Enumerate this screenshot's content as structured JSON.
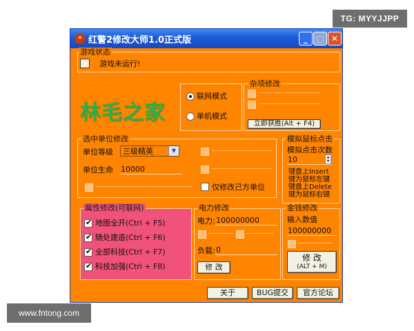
{
  "watermarks": {
    "top_right": "TG: MYYJJPP",
    "bottom_left": "www.fntong.com"
  },
  "window": {
    "title": "红警2修改大师1.0正式版",
    "title_icon": "app-icon",
    "buttons": {
      "minimize": "_",
      "maximize": "□",
      "close": "✕"
    }
  },
  "game_status": {
    "group_label": "游戏状态",
    "status_text": "游戏未运行!"
  },
  "logo_text": "林毛之家",
  "mode": {
    "online": "联网模式",
    "single": "单机模式",
    "selected": "online"
  },
  "misc": {
    "group_label": "杂项修改",
    "instant_win": "立即获胜(Alt + F4)"
  },
  "unit_edit": {
    "group_label": "选中单位修改",
    "level_label": "单位等级",
    "level_value": "三级精英",
    "life_label": "单位生命",
    "life_value": "10000",
    "own_only": "仅修改己方单位"
  },
  "mouse_sim": {
    "group_label": "模拟鼠标点击",
    "count_label": "模拟点击次数",
    "count_value": "10",
    "hint1": "键盘上Insert",
    "hint2": "键为鼠标左键",
    "hint3": "键盘上Delete",
    "hint4": "键为鼠标右键"
  },
  "attr": {
    "group_label": "属性修改(可联网)",
    "items": [
      {
        "label": "地图全开(Ctrl + F5)",
        "checked": true
      },
      {
        "label": "随处建造(Ctrl + F6)",
        "checked": true
      },
      {
        "label": "全部科技(Ctrl + F7)",
        "checked": true
      },
      {
        "label": "科技加强(Ctrl + F8)",
        "checked": true
      }
    ]
  },
  "power": {
    "group_label": "电力修改",
    "power_label": "电力:",
    "power_value": "100000000",
    "load_label": "负载:",
    "load_value": "0",
    "modify_button": "修 改"
  },
  "money": {
    "group_label": "金钱修改",
    "input_label": "输入数值",
    "input_value": "100000000",
    "modify_button_line1": "修 改",
    "modify_button_line2": "(ALT + M)"
  },
  "footer": {
    "about": "关于",
    "bug": "BUG提交",
    "forum": "官方论坛"
  }
}
